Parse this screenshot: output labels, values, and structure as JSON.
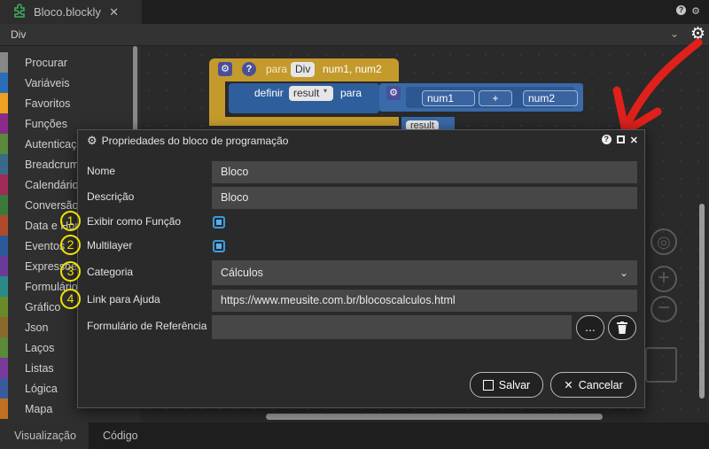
{
  "tab": {
    "title": "Bloco.blockly",
    "close": "✕"
  },
  "top_icons": {
    "help": "?",
    "settings": "⚙"
  },
  "subbar": {
    "label": "Div",
    "chevron": "⌄",
    "gear": "⚙"
  },
  "toolbox": {
    "items": [
      {
        "label": "Procurar",
        "color": "#888888"
      },
      {
        "label": "Variáveis",
        "color": "#2a6fb5"
      },
      {
        "label": "Favoritos",
        "color": "#f0a020"
      },
      {
        "label": "Funções",
        "color": "#8a2a8a"
      },
      {
        "label": "Autenticação",
        "color": "#5a8a3a"
      },
      {
        "label": "Breadcrumb",
        "color": "#3a6a8a"
      },
      {
        "label": "Calendário",
        "color": "#a02a5a"
      },
      {
        "label": "Conversão",
        "color": "#3a7a3a"
      },
      {
        "label": "Data e Hora",
        "color": "#b04a2a"
      },
      {
        "label": "Eventos",
        "color": "#2a5a9a"
      },
      {
        "label": "Expressões",
        "color": "#6a3a9a"
      },
      {
        "label": "Formulário",
        "color": "#2a8a8a"
      },
      {
        "label": "Gráfico",
        "color": "#6a8a2a"
      },
      {
        "label": "Json",
        "color": "#8a6a2a"
      },
      {
        "label": "Laços",
        "color": "#5a8a3a"
      },
      {
        "label": "Listas",
        "color": "#7a3a9a"
      },
      {
        "label": "Lógica",
        "color": "#3a5aa0"
      },
      {
        "label": "Mapa",
        "color": "#c07020"
      }
    ]
  },
  "blocks": {
    "para": "para",
    "func_name": "Div",
    "params": "num1, num2",
    "definir": "definir",
    "var_result": "result",
    "para2": "para",
    "num1": "num1",
    "op": "+",
    "num2": "num2",
    "result2": "result"
  },
  "dialog": {
    "title": "Propriedades do bloco de programação",
    "fields": {
      "nome_label": "Nome",
      "nome_value": "Bloco",
      "descricao_label": "Descrição",
      "descricao_value": "Bloco",
      "exibir_label": "Exibir como Função",
      "multilayer_label": "Multilayer",
      "categoria_label": "Categoria",
      "categoria_value": "Cálculos",
      "link_label": "Link para Ajuda",
      "link_value": "https://www.meusite.com.br/blocoscalculos.html",
      "formulario_label": "Formulário de Referência",
      "formulario_value": ""
    },
    "exibir_checked": true,
    "multilayer_checked": true,
    "browse_button": "...",
    "salvar_button": "Salvar",
    "cancelar_button": "Cancelar"
  },
  "markers": [
    "1",
    "2",
    "3",
    "4"
  ],
  "bottom_tabs": {
    "visualizacao": "Visualização",
    "codigo": "Código"
  },
  "colors": {
    "accent_check": "#3b9bde",
    "marker": "#f2e200",
    "arrow": "#e0201a",
    "block_func": "#c49a2c",
    "block_math": "#3d6fb0"
  }
}
